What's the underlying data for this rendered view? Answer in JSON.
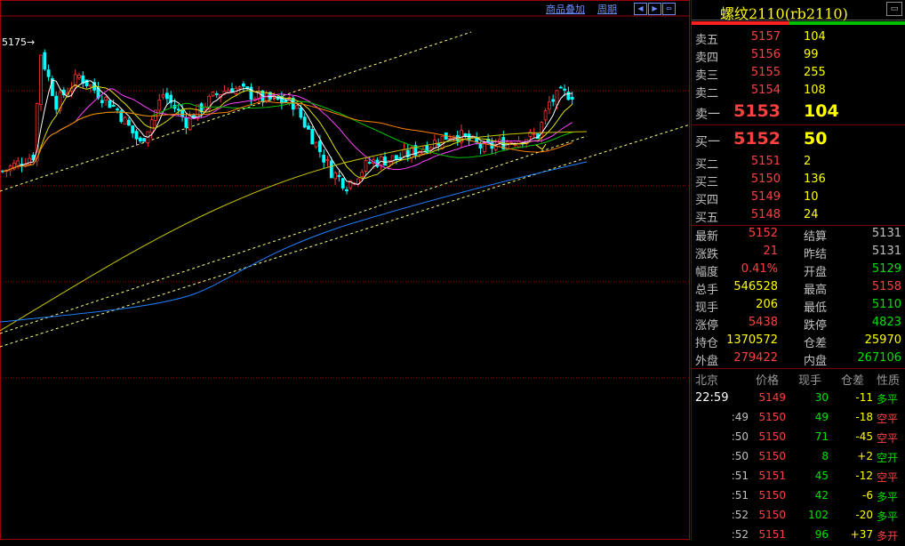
{
  "toolbar": {
    "overlay_label": "商品叠加",
    "period_label": "周期"
  },
  "chart": {
    "high_label": "5175",
    "colors": {
      "up": "#ff3030",
      "down": "#00ffff",
      "ma_white": "#ffffff",
      "ma_yellow": "#e0e000",
      "ma_magenta": "#ff40ff",
      "ma_green": "#00c000",
      "ma_orange": "#ff8000",
      "ma_olive": "#c8c800",
      "ma_blue": "#2080ff",
      "trend": "#ffff80",
      "grid": "#a00000"
    }
  },
  "chart_data": {
    "type": "candlestick",
    "title": "螺纹2110(rb2110)",
    "high": 5175,
    "last": 5152,
    "low": 5110,
    "grid": true
  },
  "quote": {
    "title": "螺纹2110(rb2110)",
    "asks": [
      {
        "label": "卖五",
        "price": "5157",
        "volume": "104"
      },
      {
        "label": "卖四",
        "price": "5156",
        "volume": "99"
      },
      {
        "label": "卖三",
        "price": "5155",
        "volume": "255"
      },
      {
        "label": "卖二",
        "price": "5154",
        "volume": "108"
      },
      {
        "label": "卖一",
        "price": "5153",
        "volume": "104"
      }
    ],
    "bids": [
      {
        "label": "买一",
        "price": "5152",
        "volume": "50"
      },
      {
        "label": "买二",
        "price": "5151",
        "volume": "2"
      },
      {
        "label": "买三",
        "price": "5150",
        "volume": "136"
      },
      {
        "label": "买四",
        "price": "5149",
        "volume": "10"
      },
      {
        "label": "买五",
        "price": "5148",
        "volume": "24"
      }
    ],
    "stats": [
      {
        "l1": "最新",
        "v1": "5152",
        "c1": "red",
        "l2": "结算",
        "v2": "5131",
        "c2": "grey"
      },
      {
        "l1": "涨跌",
        "v1": "21",
        "c1": "red",
        "l2": "昨结",
        "v2": "5131",
        "c2": "grey"
      },
      {
        "l1": "幅度",
        "v1": "0.41%",
        "c1": "red",
        "l2": "开盘",
        "v2": "5129",
        "c2": "green"
      },
      {
        "l1": "总手",
        "v1": "546528",
        "c1": "yellow",
        "l2": "最高",
        "v2": "5158",
        "c2": "red"
      },
      {
        "l1": "现手",
        "v1": "206",
        "c1": "yellow",
        "l2": "最低",
        "v2": "5110",
        "c2": "green"
      },
      {
        "l1": "涨停",
        "v1": "5438",
        "c1": "red",
        "l2": "跌停",
        "v2": "4823",
        "c2": "green"
      },
      {
        "l1": "持仓",
        "v1": "1370572",
        "c1": "yellow",
        "l2": "仓差",
        "v2": "25970",
        "c2": "yellow"
      },
      {
        "l1": "外盘",
        "v1": "279422",
        "c1": "red",
        "l2": "内盘",
        "v2": "267106",
        "c2": "green"
      }
    ],
    "ticks_header": [
      "北京",
      "价格",
      "现手",
      "仓差",
      "性质"
    ],
    "ticks": [
      {
        "time": "22:59",
        "price": "5149",
        "vol": "30",
        "oi": "-11",
        "nature": "多平",
        "nc": "green",
        "pc": "red"
      },
      {
        "time": ":49",
        "price": "5150",
        "vol": "49",
        "oi": "-18",
        "nature": "空平",
        "nc": "red",
        "pc": "red"
      },
      {
        "time": ":50",
        "price": "5150",
        "vol": "71",
        "oi": "-45",
        "nature": "空平",
        "nc": "red",
        "pc": "red"
      },
      {
        "time": ":50",
        "price": "5150",
        "vol": "8",
        "oi": "+2",
        "nature": "空开",
        "nc": "green",
        "pc": "red"
      },
      {
        "time": ":51",
        "price": "5151",
        "vol": "45",
        "oi": "-12",
        "nature": "空平",
        "nc": "red",
        "pc": "red"
      },
      {
        "time": ":51",
        "price": "5150",
        "vol": "42",
        "oi": "-6",
        "nature": "多平",
        "nc": "green",
        "pc": "red"
      },
      {
        "time": ":52",
        "price": "5150",
        "vol": "102",
        "oi": "-20",
        "nature": "多平",
        "nc": "green",
        "pc": "red"
      },
      {
        "time": ":52",
        "price": "5151",
        "vol": "96",
        "oi": "+37",
        "nature": "多开",
        "nc": "red",
        "pc": "red"
      }
    ]
  }
}
